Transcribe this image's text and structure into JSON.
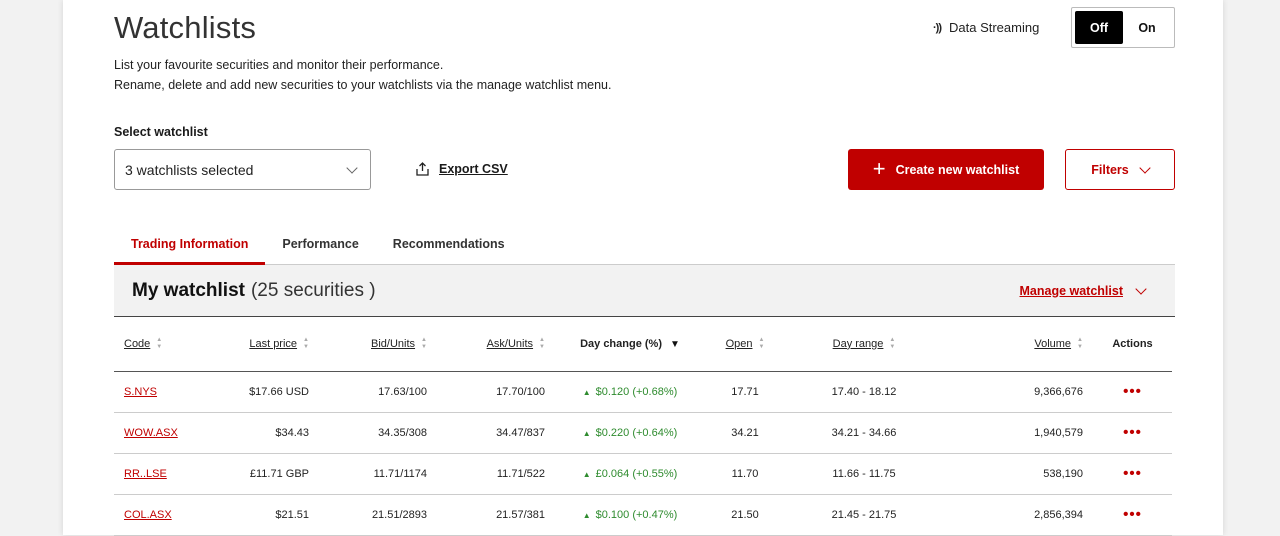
{
  "header": {
    "title": "Watchlists",
    "desc1": "List your favourite securities and monitor their performance.",
    "desc2": "Rename, delete and add new securities to your watchlists via the manage watchlist menu."
  },
  "streaming": {
    "icon": "signal-icon",
    "label": "Data Streaming",
    "off": "Off",
    "on": "On",
    "selected": "Off"
  },
  "select": {
    "label": "Select watchlist",
    "value": "3 watchlists selected"
  },
  "export": {
    "label": "Export CSV"
  },
  "create": {
    "label": "Create new watchlist"
  },
  "filters": {
    "label": "Filters"
  },
  "tabs": [
    {
      "label": "Trading Information",
      "active": true
    },
    {
      "label": "Performance",
      "active": false
    },
    {
      "label": "Recommendations",
      "active": false
    }
  ],
  "watchlist": {
    "name": "My watchlist",
    "count": "(25 securities )",
    "manage": "Manage watchlist"
  },
  "columns": [
    "Code",
    "Last price",
    "Bid/Units",
    "Ask/Units",
    "Day change (%)",
    "Open",
    "Day range",
    "Volume",
    "Actions"
  ],
  "rows": [
    {
      "code": "S.NYS",
      "last": "$17.66 USD",
      "bid": "17.63/100",
      "ask": "17.70/100",
      "change": "$0.120 (+0.68%)",
      "open": "17.71",
      "range": "17.40 - 18.12",
      "volume": "9,366,676",
      "actions": "•••"
    },
    {
      "code": "WOW.ASX",
      "last": "$34.43",
      "bid": "34.35/308",
      "ask": "34.47/837",
      "change": "$0.220 (+0.64%)",
      "open": "34.21",
      "range": "34.21 - 34.66",
      "volume": "1,940,579",
      "actions": "•••"
    },
    {
      "code": "RR..LSE",
      "last": "£11.71 GBP",
      "bid": "11.71/1174",
      "ask": "11.71/522",
      "change": "£0.064 (+0.55%)",
      "open": "11.70",
      "range": "11.66 - 11.75",
      "volume": "538,190",
      "actions": "•••"
    },
    {
      "code": "COL.ASX",
      "last": "$21.51",
      "bid": "21.51/2893",
      "ask": "21.57/381",
      "change": "$0.100 (+0.47%)",
      "open": "21.50",
      "range": "21.45 - 21.75",
      "volume": "2,856,394",
      "actions": "•••"
    }
  ],
  "colors": {
    "accent": "#c00000",
    "positive": "#2e8b2e"
  }
}
